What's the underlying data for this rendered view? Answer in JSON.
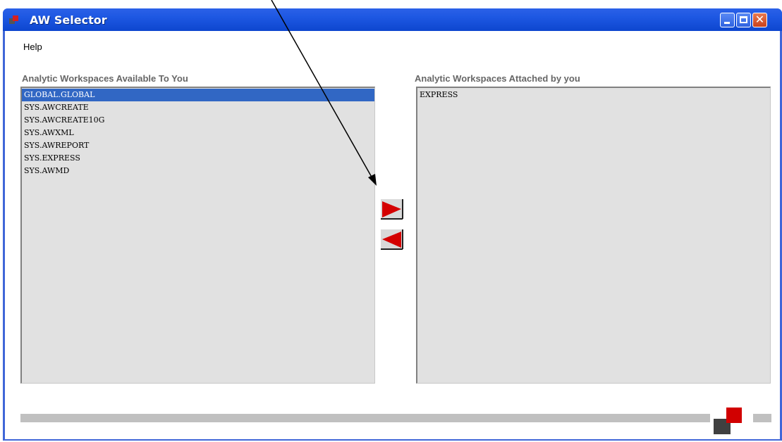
{
  "window": {
    "title": "AW Selector"
  },
  "menu": {
    "help": "Help"
  },
  "available": {
    "label": "Analytic Workspaces Available To You",
    "items": [
      "GLOBAL.GLOBAL",
      "SYS.AWCREATE",
      "SYS.AWCREATE10G",
      "SYS.AWXML",
      "SYS.AWREPORT",
      "SYS.EXPRESS",
      "SYS.AWMD"
    ],
    "selected_index": 0
  },
  "attached": {
    "label": "Analytic Workspaces Attached by you",
    "items": [
      "EXPRESS"
    ]
  },
  "colors": {
    "titlebar": "#1d57e2",
    "selection": "#3167c4",
    "list_bg": "#e1e1e1",
    "arrow_red": "#d40000",
    "logo_red": "#d10000",
    "logo_dark": "#404040"
  }
}
